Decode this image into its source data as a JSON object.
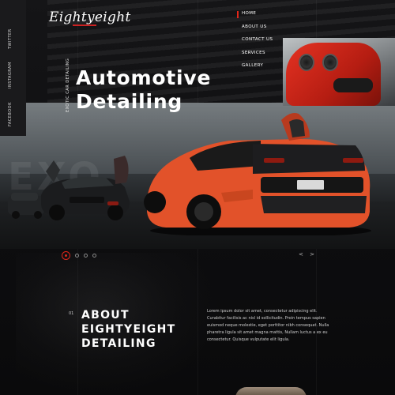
{
  "brand": {
    "logo": "Eightyeight"
  },
  "social": [
    {
      "label": "TWITTER",
      "icon": "twitter-icon"
    },
    {
      "label": "INSTAGRAM",
      "icon": "instagram-icon"
    },
    {
      "label": "FACEBOOK",
      "icon": "facebook-icon"
    }
  ],
  "nav": {
    "items": [
      "HOME",
      "ABOUT US",
      "CONTACT US",
      "SERVICES",
      "GALLERY"
    ],
    "active_index": 0
  },
  "hero": {
    "tagline": "EXOTIC CAR DETAILING",
    "title_line1": "Automotive",
    "title_line2": "Detailing",
    "ghost_text": "EXO",
    "slides": {
      "count": 4,
      "active": 1
    },
    "arrows": "< >"
  },
  "about": {
    "number": "01",
    "title_line1": "ABOUT",
    "title_line2": "EIGHTYEIGHT",
    "title_line3": "DETAILING",
    "body": "Lorem ipsum dolor sit amet, consectetur adipiscing elit. Curabitur facilisis ac nisl id sollicitudin. Proin tempus sapien euismod neque molestie, eget porttitor nibh consequat. Nulla pharetra ligula sit amet magna mattis, Nullam luctus a ex eu consectetur. Quisque vulputate elit ligula."
  },
  "colors": {
    "accent": "#e32619",
    "background": "#0b0b0c",
    "car_orange": "#e2522a"
  }
}
